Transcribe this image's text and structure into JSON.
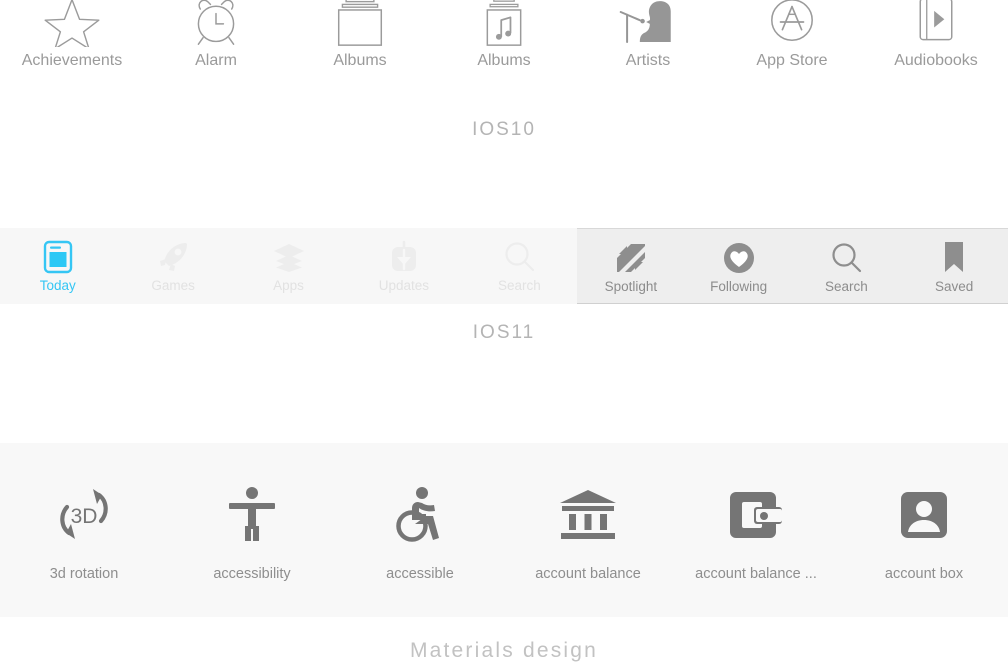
{
  "sections": {
    "ios10": {
      "caption": "IOS10",
      "items": [
        {
          "label": "Achievements",
          "icon": "star-outline-icon"
        },
        {
          "label": "Alarm",
          "icon": "alarm-clock-icon"
        },
        {
          "label": "Albums",
          "icon": "albums-stack-icon"
        },
        {
          "label": "Albums",
          "icon": "albums-music-note-icon"
        },
        {
          "label": "Artists",
          "icon": "artist-microphone-icon"
        },
        {
          "label": "App Store",
          "icon": "app-store-icon"
        },
        {
          "label": "Audiobooks",
          "icon": "audiobook-play-icon"
        }
      ]
    },
    "ios11": {
      "caption": "IOS11",
      "left_bar": {
        "background": "#f7f7f7",
        "active_color": "#35c6f4",
        "inactive_color": "#e2e2e2",
        "tabs": [
          {
            "label": "Today",
            "icon": "today-card-icon",
            "active": true
          },
          {
            "label": "Games",
            "icon": "rocket-icon",
            "active": false
          },
          {
            "label": "Apps",
            "icon": "layers-stack-icon",
            "active": false
          },
          {
            "label": "Updates",
            "icon": "download-box-icon",
            "active": false
          },
          {
            "label": "Search",
            "icon": "magnifier-icon",
            "active": false
          }
        ]
      },
      "right_bar": {
        "background": "#eeeeee",
        "label_color": "#8c8c8c",
        "tabs": [
          {
            "label": "Spotlight",
            "icon": "news-n-icon"
          },
          {
            "label": "Following",
            "icon": "heart-circle-icon"
          },
          {
            "label": "Search",
            "icon": "magnifier-icon"
          },
          {
            "label": "Saved",
            "icon": "bookmark-icon"
          }
        ]
      }
    },
    "material": {
      "caption": "Materials design",
      "background": "#f8f8f8",
      "icon_color": "#757575",
      "items": [
        {
          "label": "3d rotation",
          "icon": "3d-rotation-icon"
        },
        {
          "label": "accessibility",
          "icon": "accessibility-icon"
        },
        {
          "label": "accessible",
          "icon": "accessible-wheelchair-icon"
        },
        {
          "label": "account balance",
          "icon": "account-balance-bank-icon"
        },
        {
          "label": "account balance ...",
          "icon": "account-balance-wallet-icon"
        },
        {
          "label": "account box",
          "icon": "account-box-icon"
        }
      ]
    }
  }
}
